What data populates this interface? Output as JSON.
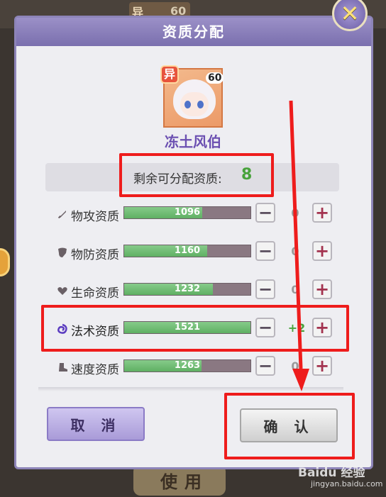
{
  "background": {
    "top_badge_text": "异",
    "top_badge_level": "60",
    "bottom_button_label": "使用"
  },
  "dialog": {
    "title": "资质分配",
    "close_icon": "close-x-icon"
  },
  "hero": {
    "badge": "异",
    "level": "60",
    "name": "冻土风伯"
  },
  "remaining": {
    "label": "剩余可分配资质:",
    "value": "8"
  },
  "stats": [
    {
      "icon": "sword-icon",
      "label": "物攻资质",
      "value_text": "1096",
      "fill": 0.62,
      "allocated": "0"
    },
    {
      "icon": "shield-icon",
      "label": "物防资质",
      "value_text": "1160",
      "fill": 0.66,
      "allocated": "0"
    },
    {
      "icon": "heart-icon",
      "label": "生命资质",
      "value_text": "1232",
      "fill": 0.7,
      "allocated": "0"
    },
    {
      "icon": "magic-swirl-icon",
      "label": "法术资质",
      "value_text": "1521",
      "fill": 1.0,
      "allocated": "+2"
    },
    {
      "icon": "boot-icon",
      "label": "速度资质",
      "value_text": "1263",
      "fill": 0.61,
      "allocated": "0"
    }
  ],
  "buttons": {
    "cancel": "取 消",
    "confirm": "确 认"
  },
  "colors": {
    "header": "#8d84b8",
    "highlight": "#ee1c1c",
    "remaining_value": "#48a23c",
    "hero_name": "#6b4fb1"
  },
  "watermark": {
    "main": "Baidu 经验",
    "sub": "jingyan.baidu.com"
  }
}
